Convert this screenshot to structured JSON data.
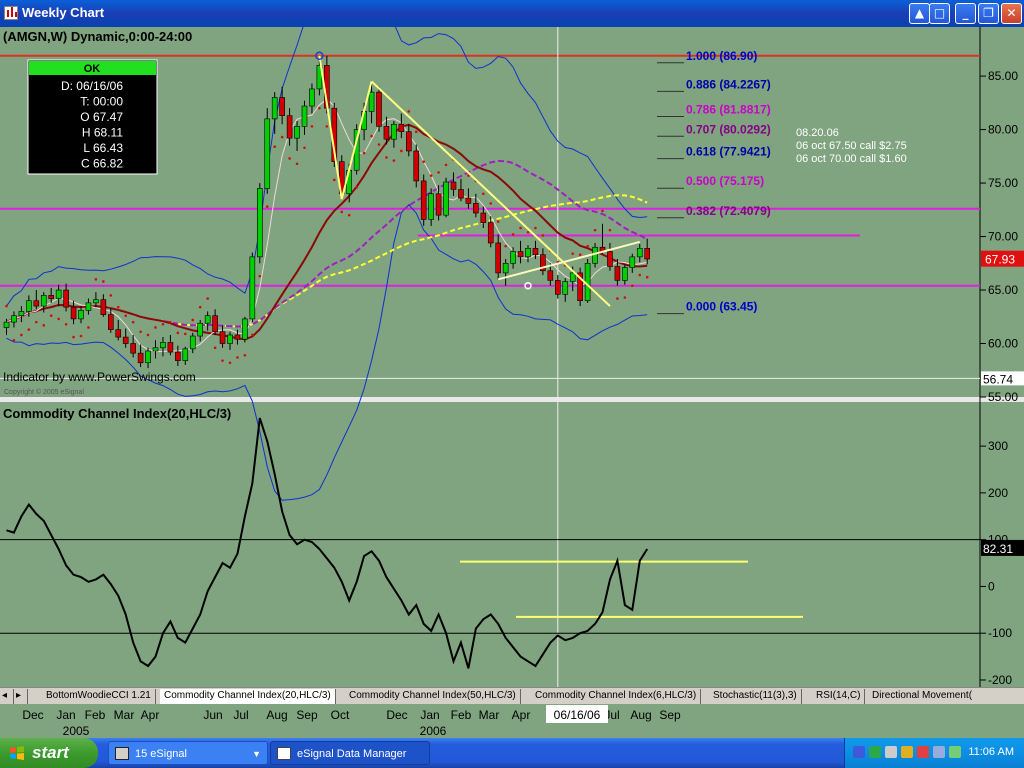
{
  "window": {
    "title": "Weekly Chart"
  },
  "taskbar": {
    "start_label": "start",
    "items": [
      {
        "label": "15 eSignal"
      },
      {
        "label": "eSignal Data Manager"
      }
    ],
    "clock": "11:06 AM"
  },
  "panel_tabs": [
    "BottomWoodieCCI 1.21",
    "Commodity Channel Index(20,HLC/3)",
    "Commodity Channel Index(50,HLC/3)",
    "Commodity Channel Index(6,HLC/3)",
    "Stochastic(11(3),3)",
    "RSI(14,C)",
    "Directional Movement("
  ],
  "date_axis": {
    "months": [
      {
        "label": "Dec",
        "x": 33
      },
      {
        "label": "Jan",
        "x": 66
      },
      {
        "label": "Feb",
        "x": 95
      },
      {
        "label": "Mar",
        "x": 124
      },
      {
        "label": "Apr",
        "x": 150
      },
      {
        "label": "Jun",
        "x": 213
      },
      {
        "label": "Jul",
        "x": 241
      },
      {
        "label": "Aug",
        "x": 277
      },
      {
        "label": "Sep",
        "x": 307
      },
      {
        "label": "Oct",
        "x": 340
      },
      {
        "label": "Dec",
        "x": 397
      },
      {
        "label": "Jan",
        "x": 430
      },
      {
        "label": "Feb",
        "x": 461
      },
      {
        "label": "Mar",
        "x": 489
      },
      {
        "label": "Apr",
        "x": 521
      },
      {
        "label": "Jul",
        "x": 612
      },
      {
        "label": "Aug",
        "x": 641
      },
      {
        "label": "Sep",
        "x": 670
      }
    ],
    "years": [
      {
        "label": "2005",
        "x": 76
      },
      {
        "label": "2006",
        "x": 433
      }
    ],
    "cursor_date": "06/16/06"
  },
  "chart_data": [
    {
      "type": "candlestick",
      "title": "(AMGN,W) Dynamic,0:00-24:00",
      "ylim": [
        55,
        88
      ],
      "y_ticks": [
        55,
        60,
        65,
        70,
        75,
        80,
        85
      ],
      "y_tick_labels": [
        "55.00",
        "60.00",
        "65.00",
        "70.00",
        "75.00",
        "80.00",
        "85.00"
      ],
      "cursor_price": "56.74",
      "last_price": "67.93",
      "data_window": {
        "status": "OK",
        "lines": [
          "D: 06/16/06",
          "T: 00:00",
          "O 67.47",
          "H 68.11",
          "L 66.43",
          "C 66.82"
        ]
      },
      "candles": [
        [
          61.5,
          62.3,
          60.8,
          62.0
        ],
        [
          62.0,
          63.0,
          61.5,
          62.6
        ],
        [
          62.6,
          63.5,
          62.0,
          63.0
        ],
        [
          63.0,
          64.5,
          62.5,
          64.0
        ],
        [
          64.0,
          65.0,
          63.2,
          63.5
        ],
        [
          63.5,
          64.8,
          62.9,
          64.5
        ],
        [
          64.5,
          65.2,
          63.8,
          64.2
        ],
        [
          64.2,
          65.5,
          63.5,
          65.0
        ],
        [
          65.0,
          65.6,
          63.0,
          63.4
        ],
        [
          63.4,
          64.0,
          61.8,
          62.3
        ],
        [
          62.3,
          63.5,
          61.9,
          63.1
        ],
        [
          63.1,
          64.2,
          62.7,
          63.8
        ],
        [
          63.8,
          64.8,
          63.4,
          64.1
        ],
        [
          64.1,
          64.6,
          62.5,
          62.7
        ],
        [
          62.7,
          63.3,
          61.0,
          61.3
        ],
        [
          61.3,
          62.2,
          60.3,
          60.6
        ],
        [
          60.6,
          61.4,
          59.6,
          60.0
        ],
        [
          60.0,
          60.8,
          58.7,
          59.1
        ],
        [
          59.1,
          59.9,
          57.8,
          58.2
        ],
        [
          58.2,
          59.6,
          57.7,
          59.3
        ],
        [
          59.3,
          60.3,
          58.6,
          59.6
        ],
        [
          59.6,
          60.6,
          58.8,
          60.1
        ],
        [
          60.1,
          60.8,
          58.9,
          59.2
        ],
        [
          59.2,
          59.8,
          57.9,
          58.4
        ],
        [
          58.4,
          59.7,
          58.0,
          59.5
        ],
        [
          59.5,
          61.0,
          59.1,
          60.7
        ],
        [
          60.7,
          62.2,
          60.2,
          61.9
        ],
        [
          61.9,
          63.0,
          61.2,
          62.6
        ],
        [
          62.6,
          63.2,
          60.8,
          61.1
        ],
        [
          61.1,
          61.7,
          59.6,
          60.0
        ],
        [
          60.0,
          61.1,
          59.4,
          60.8
        ],
        [
          60.8,
          61.3,
          59.9,
          60.4
        ],
        [
          60.4,
          62.5,
          60.1,
          62.3
        ],
        [
          62.3,
          68.5,
          62.0,
          68.1
        ],
        [
          68.1,
          75.0,
          67.5,
          74.5
        ],
        [
          74.5,
          82.0,
          74.0,
          81.0
        ],
        [
          81.0,
          83.5,
          79.6,
          83.0
        ],
        [
          83.0,
          84.0,
          80.5,
          81.3
        ],
        [
          81.3,
          82.0,
          78.5,
          79.2
        ],
        [
          79.2,
          80.8,
          78.0,
          80.3
        ],
        [
          80.3,
          82.7,
          79.5,
          82.2
        ],
        [
          82.2,
          84.3,
          81.5,
          83.8
        ],
        [
          83.8,
          86.8,
          83.2,
          86.0
        ],
        [
          86.0,
          86.9,
          81.5,
          82.0
        ],
        [
          82.0,
          82.5,
          76.5,
          77.0
        ],
        [
          77.0,
          77.6,
          73.5,
          74.0
        ],
        [
          74.0,
          76.8,
          73.2,
          76.2
        ],
        [
          76.2,
          80.5,
          75.8,
          80.0
        ],
        [
          80.0,
          82.5,
          79.0,
          81.7
        ],
        [
          81.7,
          84.5,
          80.6,
          83.5
        ],
        [
          83.5,
          84.0,
          79.8,
          80.3
        ],
        [
          80.3,
          81.2,
          78.6,
          79.1
        ],
        [
          79.1,
          80.8,
          78.3,
          80.5
        ],
        [
          80.5,
          81.5,
          79.2,
          79.8
        ],
        [
          79.8,
          80.5,
          77.5,
          78.0
        ],
        [
          78.0,
          78.6,
          74.6,
          75.2
        ],
        [
          75.2,
          75.8,
          71.0,
          71.6
        ],
        [
          71.6,
          74.5,
          71.0,
          74.0
        ],
        [
          74.0,
          74.8,
          71.5,
          72.0
        ],
        [
          72.0,
          75.5,
          71.8,
          75.1
        ],
        [
          75.1,
          76.0,
          73.8,
          74.4
        ],
        [
          74.4,
          75.4,
          73.3,
          73.6
        ],
        [
          73.6,
          74.5,
          72.6,
          73.1
        ],
        [
          73.1,
          74.0,
          71.8,
          72.2
        ],
        [
          72.2,
          72.8,
          70.8,
          71.3
        ],
        [
          71.3,
          71.9,
          69.0,
          69.4
        ],
        [
          69.4,
          70.2,
          66.0,
          66.6
        ],
        [
          66.6,
          67.9,
          65.4,
          67.5
        ],
        [
          67.5,
          69.0,
          67.0,
          68.6
        ],
        [
          68.6,
          69.6,
          67.5,
          68.1
        ],
        [
          68.1,
          69.2,
          67.6,
          68.9
        ],
        [
          68.9,
          69.6,
          67.9,
          68.3
        ],
        [
          68.3,
          68.9,
          66.4,
          66.8
        ],
        [
          66.8,
          67.5,
          65.4,
          65.9
        ],
        [
          65.9,
          66.4,
          64.2,
          64.6
        ],
        [
          64.6,
          66.1,
          63.9,
          65.8
        ],
        [
          65.8,
          67.2,
          64.9,
          66.6
        ],
        [
          66.6,
          67.1,
          63.5,
          64.0
        ],
        [
          64.0,
          67.9,
          63.8,
          67.5
        ],
        [
          67.5,
          69.4,
          67.1,
          69.0
        ],
        [
          69.0,
          71.2,
          68.4,
          68.6
        ],
        [
          68.6,
          69.4,
          66.8,
          67.2
        ],
        [
          67.2,
          67.9,
          65.4,
          65.9
        ],
        [
          65.9,
          67.4,
          65.5,
          67.1
        ],
        [
          67.1,
          68.4,
          66.6,
          68.1
        ],
        [
          68.1,
          69.3,
          67.6,
          68.9
        ],
        [
          68.9,
          69.8,
          67.4,
          67.9
        ]
      ],
      "fib_levels": [
        {
          "label": "1.000 (86.90)",
          "value": 86.9,
          "color": "#0000cc"
        },
        {
          "label": "0.886 (84.2267)",
          "value": 84.2267,
          "color": "#0000aa"
        },
        {
          "label": "0.786 (81.8817)",
          "value": 81.8817,
          "color": "#cc00cc"
        },
        {
          "label": "0.707 (80.0292)",
          "value": 80.0292,
          "color": "#880088"
        },
        {
          "label": "0.618 (77.9421)",
          "value": 77.9421,
          "color": "#0000aa"
        },
        {
          "label": "0.500 (75.175)",
          "value": 75.175,
          "color": "#cc00cc"
        },
        {
          "label": "0.382 (72.4079)",
          "value": 72.4079,
          "color": "#880088"
        },
        {
          "label": "0.000 (63.45)",
          "value": 63.45,
          "color": "#0000cc"
        }
      ],
      "horizontal_lines": [
        {
          "value": 86.9,
          "color": "#e03020"
        },
        {
          "value": 72.6,
          "color": "#e020e0"
        },
        {
          "value": 65.4,
          "color": "#e020e0"
        },
        {
          "value": 70.1,
          "color": "#e020e0"
        }
      ],
      "annotations": [
        "08.20.06",
        "06 oct 67.50 call $2.75",
        "06 oct 70.00 call $1.60"
      ],
      "credit": "Indicator by www.PowerSwings.com",
      "credit_small": "Copyright © 2005 eSignal"
    },
    {
      "type": "line",
      "title": "Commodity Channel Index(20,HLC/3)",
      "ylim": [
        -215,
        390
      ],
      "y_ticks": [
        -200,
        -100,
        0,
        100,
        200,
        300
      ],
      "y_tick_labels": [
        "-200",
        "-100",
        "0",
        "100",
        "200",
        "300"
      ],
      "last_value": "82.31",
      "reference_lines": [
        100,
        -100
      ],
      "yellow_levels": [
        53,
        -65
      ],
      "values": [
        120,
        115,
        150,
        175,
        155,
        140,
        110,
        80,
        45,
        25,
        20,
        10,
        15,
        25,
        5,
        -20,
        -60,
        -120,
        -160,
        -170,
        -150,
        -100,
        -75,
        -110,
        -120,
        -90,
        -60,
        -10,
        20,
        50,
        40,
        70,
        150,
        220,
        360,
        310,
        240,
        160,
        110,
        90,
        100,
        95,
        80,
        60,
        40,
        10,
        -30,
        10,
        65,
        75,
        55,
        20,
        -5,
        -30,
        -60,
        -40,
        -80,
        -95,
        -60,
        -100,
        -160,
        -120,
        -175,
        -90,
        -70,
        -60,
        -80,
        -110,
        -130,
        -150,
        -160,
        -170,
        -145,
        -120,
        -105,
        -115,
        -110,
        -100,
        -95,
        -80,
        -55,
        15,
        55,
        -40,
        -50,
        55,
        80
      ]
    }
  ]
}
